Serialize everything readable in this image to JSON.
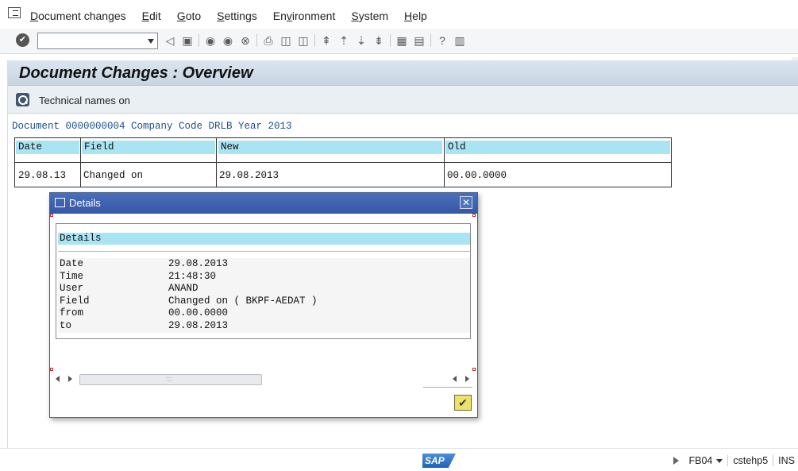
{
  "menu": {
    "items": [
      {
        "pre": "",
        "u": "D",
        "post": "ocument changes"
      },
      {
        "pre": "",
        "u": "E",
        "post": "dit"
      },
      {
        "pre": "",
        "u": "G",
        "post": "oto"
      },
      {
        "pre": "",
        "u": "S",
        "post": "ettings"
      },
      {
        "pre": "En",
        "u": "v",
        "post": "ironment"
      },
      {
        "pre": "",
        "u": "S",
        "post": "ystem"
      },
      {
        "pre": "",
        "u": "H",
        "post": "elp"
      }
    ]
  },
  "toolbar": {
    "command_value": "",
    "icons": [
      "check-icon",
      "back-icon",
      "save-icon",
      "back-nav-icon",
      "exit-icon",
      "cancel-icon",
      "print-icon",
      "find-icon",
      "find-next-icon",
      "first-page-icon",
      "previous-page-icon",
      "next-page-icon",
      "last-page-icon",
      "create-session-icon",
      "shortcut-icon",
      "help-icon",
      "layout-icon"
    ]
  },
  "header": {
    "title": "Document Changes : Overview",
    "tech_names_label": "Technical names on"
  },
  "document_line": "Document 0000000004 Company Code DRLB Year 2013",
  "grid": {
    "columns": [
      "Date",
      "Field",
      "New",
      "Old"
    ],
    "rows": [
      {
        "date": "29.08.13",
        "field": "Changed on",
        "new": "29.08.2013",
        "old": "00.00.0000"
      }
    ]
  },
  "dialog": {
    "title": "Details",
    "section_title": "Details",
    "rows": [
      {
        "label": "Date",
        "value": "29.08.2013"
      },
      {
        "label": "Time",
        "value": "21:48:30"
      },
      {
        "label": "User",
        "value": "ANAND"
      },
      {
        "label": "Field",
        "value": "Changed on ( BKPF-AEDAT )"
      },
      {
        "label": "from",
        "value": "00.00.0000"
      },
      {
        "label": "to",
        "value": "29.08.2013"
      }
    ],
    "scroll_grip": ":::",
    "ok_glyph": "✔",
    "close_glyph": "✕"
  },
  "status": {
    "sap_logo": "SAP",
    "transaction": "FB04",
    "server": "cstehp5",
    "mode": "INS"
  },
  "colors": {
    "title_bar": "#c7d5e2",
    "dialog_title_bar": "#3458a6",
    "grid_header": "#a9e4f3",
    "doc_line_text": "#1f4e8c",
    "ok_button": "#f0e070"
  }
}
